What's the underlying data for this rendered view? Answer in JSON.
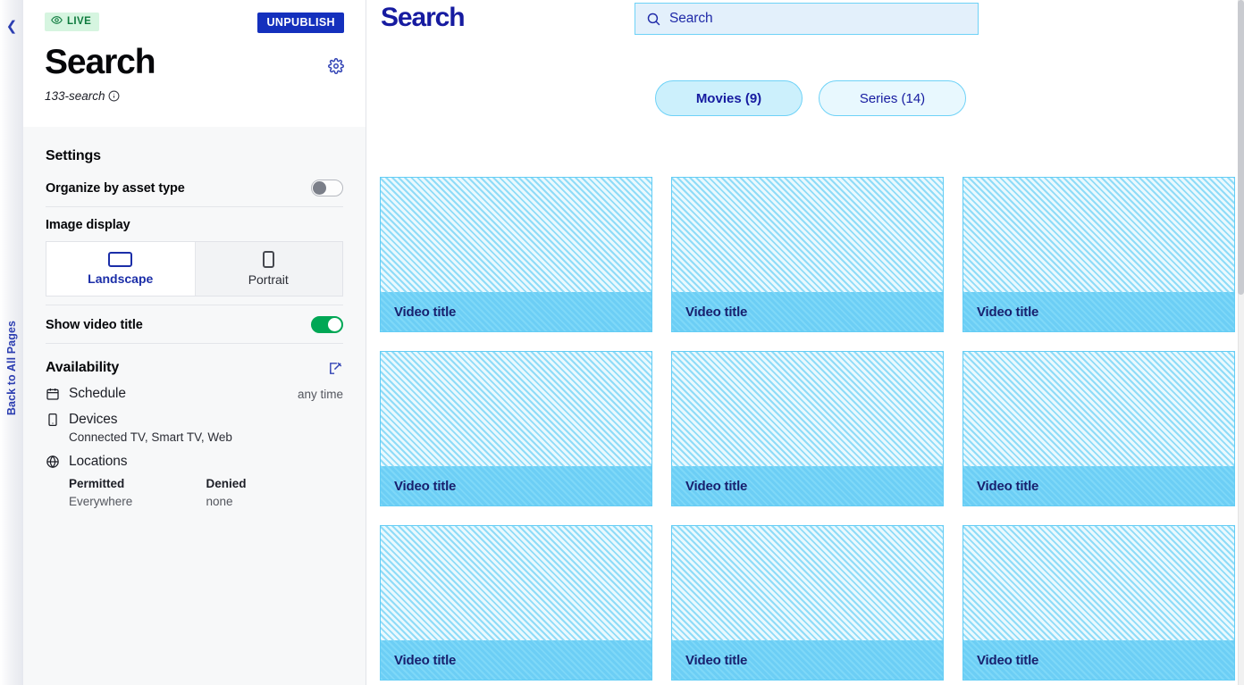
{
  "rail": {
    "collapse_icon": "chevron-left-icon",
    "back_label": "Back to All Pages"
  },
  "panel": {
    "status_badge": {
      "label": "LIVE",
      "icon": "eye-icon",
      "bg_color": "#d6f5e0",
      "text_color": "#0d7a3d"
    },
    "unpublish_label": "UNPUBLISH",
    "unpublish_color": "#1430bd",
    "title": "Search",
    "settings_icon": "gear-icon",
    "slug": "133-search",
    "slug_info_icon": "info-circle-icon",
    "settings": {
      "heading": "Settings",
      "organize_label": "Organize by asset type",
      "organize_state": "off",
      "image_display_label": "Image display",
      "image_display_options": [
        {
          "label": "Landscape",
          "icon": "rectangle-landscape-icon",
          "selected": true
        },
        {
          "label": "Portrait",
          "icon": "rectangle-portrait-icon",
          "selected": false
        }
      ],
      "show_video_title_label": "Show video title",
      "show_video_title_state": "on",
      "toggle_on_color": "#00a755"
    },
    "availability": {
      "heading": "Availability",
      "edit_icon": "edit-pencil-icon",
      "schedule": {
        "icon": "calendar-icon",
        "label": "Schedule",
        "value": "any time"
      },
      "devices": {
        "icon": "device-mobile-icon",
        "label": "Devices",
        "value": "Connected TV, Smart TV, Web"
      },
      "locations": {
        "icon": "globe-icon",
        "label": "Locations",
        "permitted_header": "Permitted",
        "permitted_value": "Everywhere",
        "denied_header": "Denied",
        "denied_value": "none"
      }
    }
  },
  "preview": {
    "title": "Search",
    "title_color": "#161ba0",
    "search": {
      "icon": "search-icon",
      "placeholder": "Search",
      "value": "Search"
    },
    "filters": [
      {
        "label": "Movies (9)",
        "selected": true
      },
      {
        "label": "Series (14)",
        "selected": false
      }
    ],
    "accent_border": "#6ed2f7",
    "cards": [
      {
        "title": "Video title"
      },
      {
        "title": "Video title"
      },
      {
        "title": "Video title"
      },
      {
        "title": "Video title"
      },
      {
        "title": "Video title"
      },
      {
        "title": "Video title"
      },
      {
        "title": "Video title"
      },
      {
        "title": "Video title"
      },
      {
        "title": "Video title"
      }
    ]
  }
}
